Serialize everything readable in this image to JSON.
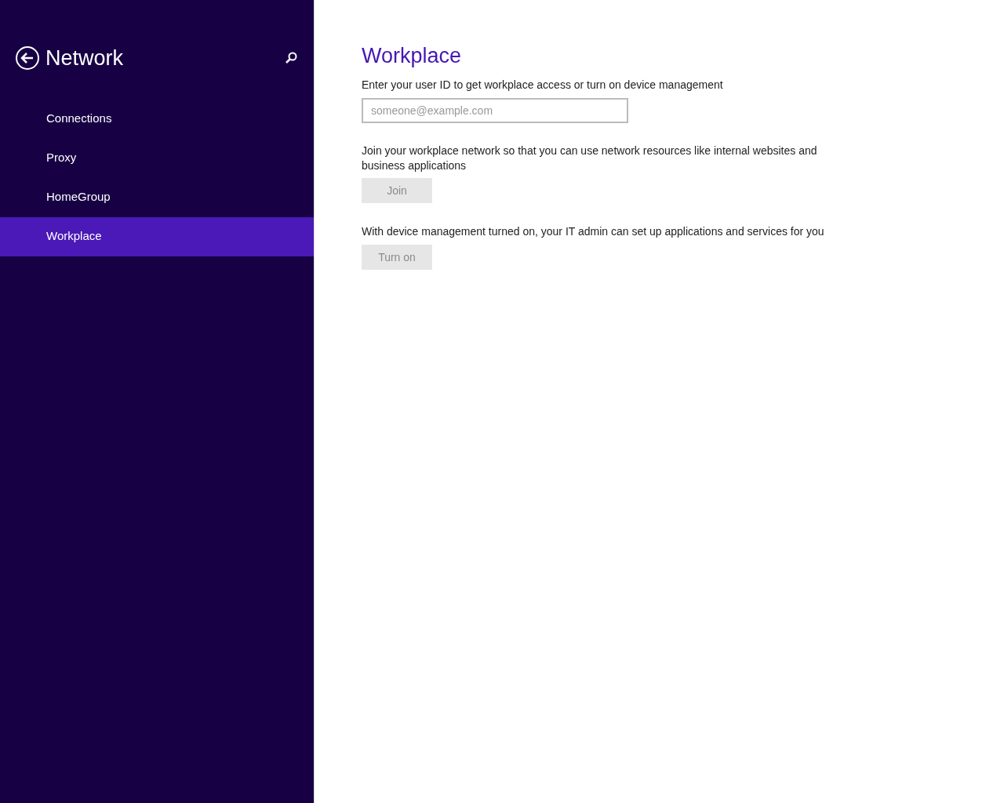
{
  "sidebar": {
    "title": "Network",
    "items": [
      {
        "label": "Connections",
        "selected": false
      },
      {
        "label": "Proxy",
        "selected": false
      },
      {
        "label": "HomeGroup",
        "selected": false
      },
      {
        "label": "Workplace",
        "selected": true
      }
    ]
  },
  "content": {
    "title": "Workplace",
    "user_id": {
      "label": "Enter your user ID to get workplace access or turn on device management",
      "placeholder": "someone@example.com"
    },
    "join": {
      "description": "Join your workplace network so that you can use network resources like internal websites and business applications",
      "button": {
        "label": "Join",
        "disabled": true
      }
    },
    "device_management": {
      "description": "With device management turned on, your IT admin can set up applications and services for you",
      "button": {
        "label": "Turn on",
        "disabled": true
      }
    }
  }
}
